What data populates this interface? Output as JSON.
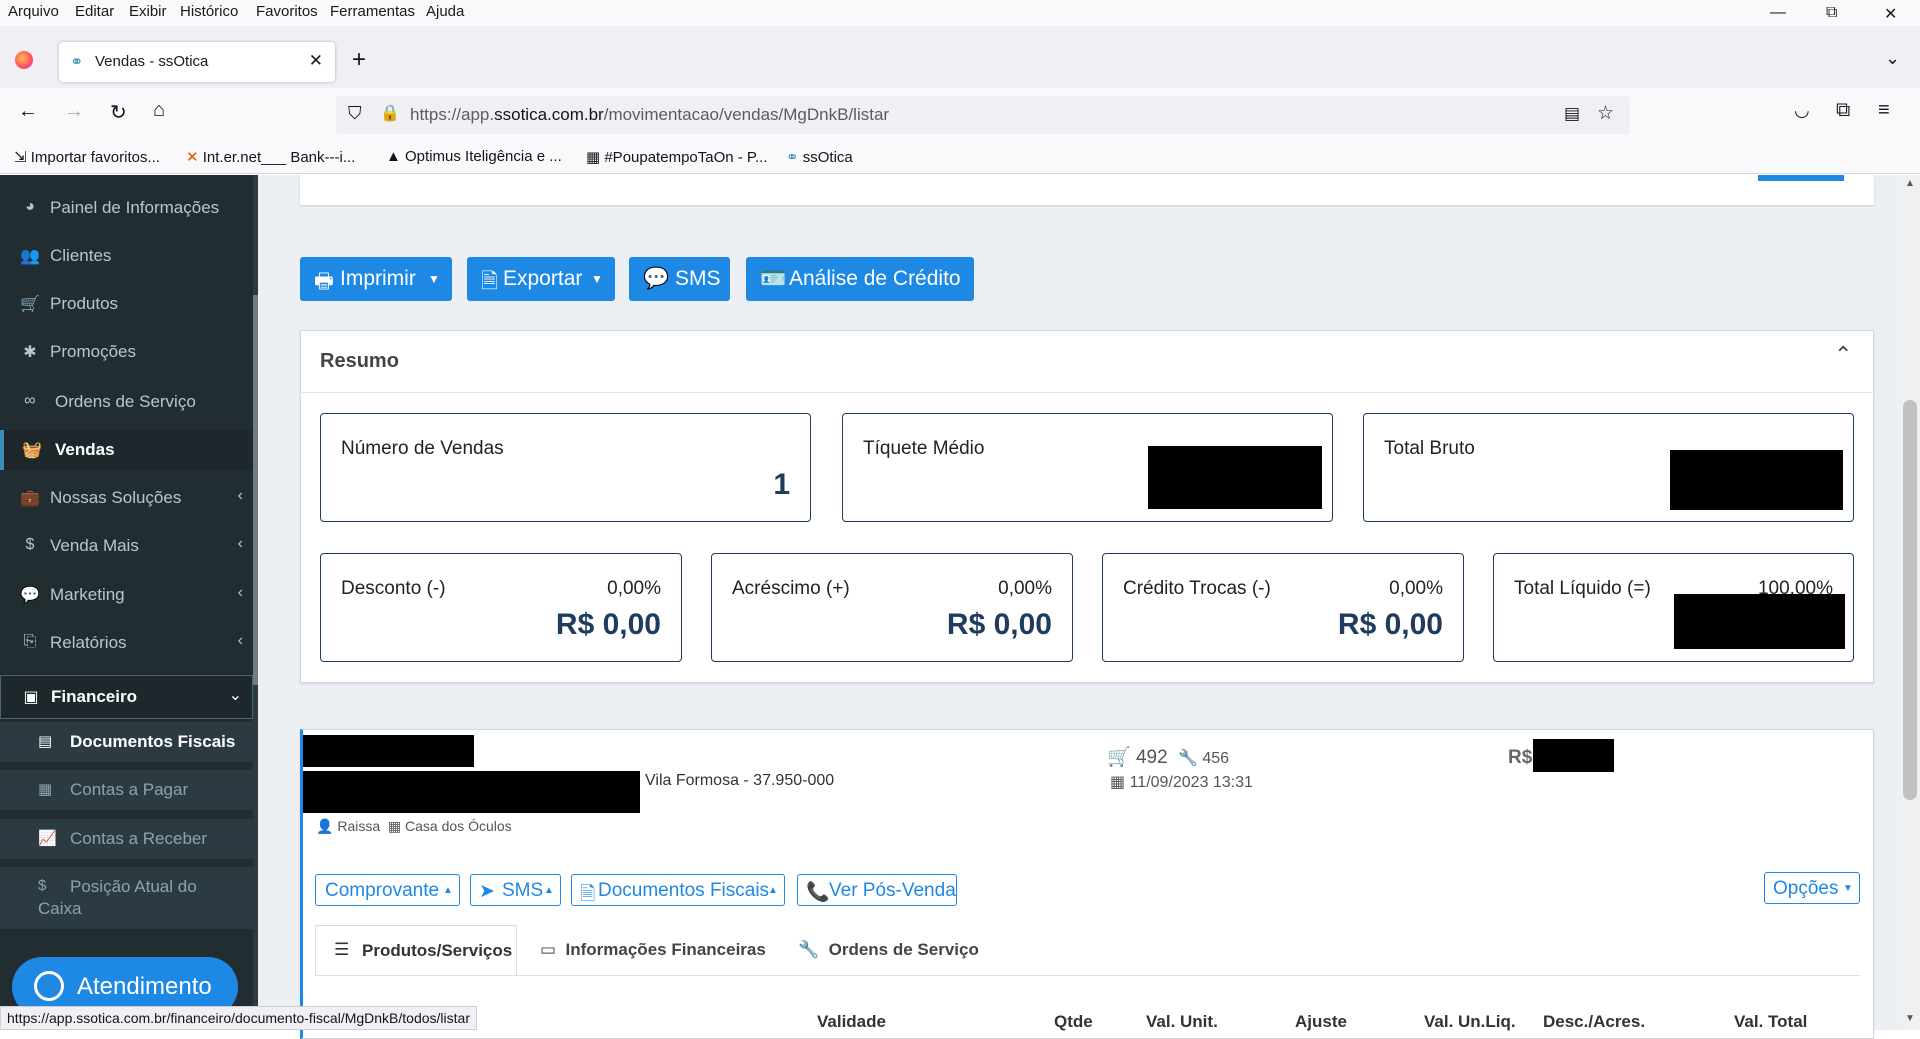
{
  "menubar": [
    "Arquivo",
    "Editar",
    "Exibir",
    "Histórico",
    "Favoritos",
    "Ferramentas",
    "Ajuda"
  ],
  "window_controls": {
    "minimize": "—",
    "maximize": "⧉",
    "close": "✕"
  },
  "tab": {
    "title": "Vendas - ssOtica",
    "close": "✕",
    "new": "+"
  },
  "address": {
    "prefix": "https://app.",
    "domain": "ssotica.com.br",
    "path": "/movimentacao/vendas/MgDnkB/listar"
  },
  "bookmarks": [
    "Importar favoritos...",
    "Int.er.net___ Bank---i...",
    "Optimus Iteligência e ...",
    "#PoupatempoTaOn - P...",
    "ssOtica"
  ],
  "sidebar": {
    "items": [
      {
        "label": "Painel de Informações",
        "icon": "dashboard-icon",
        "glyph": "◕"
      },
      {
        "label": "Clientes",
        "icon": "users-icon",
        "glyph": "👥"
      },
      {
        "label": "Produtos",
        "icon": "cart-icon",
        "glyph": "🛒"
      },
      {
        "label": "Promoções",
        "icon": "asterisk-icon",
        "glyph": "✱"
      },
      {
        "label": "Ordens de Serviço",
        "icon": "glasses-icon",
        "glyph": "∞"
      },
      {
        "label": "Vendas",
        "icon": "basket-icon",
        "glyph": "🧺"
      },
      {
        "label": "Nossas Soluções",
        "icon": "briefcase-icon",
        "glyph": "💼"
      },
      {
        "label": "Venda Mais",
        "icon": "dollar-icon",
        "glyph": "$"
      },
      {
        "label": "Marketing",
        "icon": "chat-icon",
        "glyph": "💬"
      },
      {
        "label": "Relatórios",
        "icon": "copy-icon",
        "glyph": "⎘"
      },
      {
        "label": "Financeiro",
        "icon": "money-icon",
        "glyph": "▣"
      }
    ],
    "subitems": [
      {
        "label": "Documentos Fiscais",
        "icon": "file-icon",
        "glyph": "▤"
      },
      {
        "label": "Contas a Pagar",
        "icon": "calculator-icon",
        "glyph": "▦"
      },
      {
        "label": "Contas a Receber",
        "icon": "chart-icon",
        "glyph": "📈"
      },
      {
        "label": "Posição Atual do",
        "label2": "Caixa",
        "icon": "dollar-icon",
        "glyph": "$"
      }
    ],
    "atendimento": "Atendimento"
  },
  "status_url": "https://app.ssotica.com.br/financeiro/documento-fiscal/MgDnkB/todos/listar",
  "actions": {
    "imprimir": "Imprimir",
    "exportar": "Exportar",
    "sms": "SMS",
    "analise": "Análise de Crédito"
  },
  "resumo": {
    "title": "Resumo",
    "numero_vendas": {
      "label": "Número de Vendas",
      "value": "1"
    },
    "tiquete_medio": {
      "label": "Tíquete Médio"
    },
    "total_bruto": {
      "label": "Total Bruto"
    },
    "desconto": {
      "label": "Desconto (-)",
      "pct": "0,00%",
      "value": "R$ 0,00"
    },
    "acrescimo": {
      "label": "Acréscimo (+)",
      "pct": "0,00%",
      "value": "R$ 0,00"
    },
    "credito_trocas": {
      "label": "Crédito Trocas (-)",
      "pct": "0,00%",
      "value": "R$ 0,00"
    },
    "total_liquido": {
      "label": "Total Líquido (=)",
      "pct": "100,00%"
    }
  },
  "venda": {
    "address": "Vila Formosa - 37.950-000",
    "cart_count": "492",
    "wrench_count": "456",
    "datetime": "11/09/2023 13:31",
    "currency": "R$",
    "seller": "Raissa",
    "store": "Casa dos Óculos",
    "buttons": {
      "comprovante": "Comprovante",
      "sms": "SMS",
      "docs": "Documentos Fiscais",
      "pos": "Ver Pós-Venda",
      "opcoes": "Opções"
    },
    "tabs": [
      "Produtos/Serviços",
      "Informações Financeiras",
      "Ordens de Serviço"
    ],
    "table_headers": [
      "Validade",
      "Qtde",
      "Val. Unit.",
      "Ajuste",
      "Val. Un.Liq.",
      "Desc./Acres.",
      "Val. Total"
    ]
  }
}
